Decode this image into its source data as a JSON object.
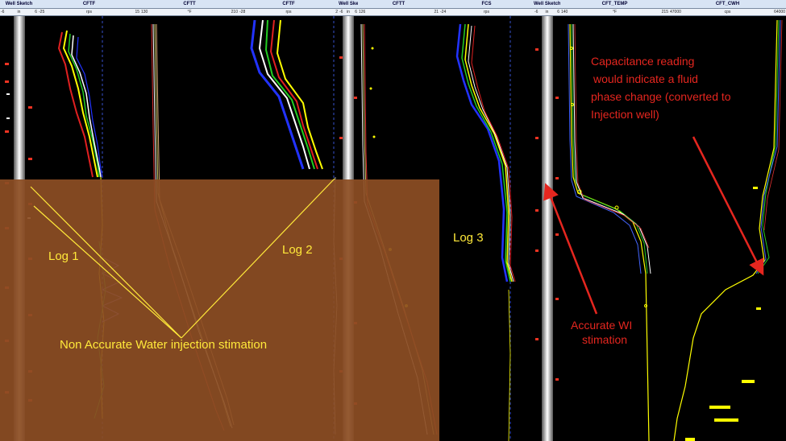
{
  "left_panel": {
    "tracks": [
      {
        "id": "well-sketch-1",
        "title": "Well Sketch",
        "scale_left": "-6",
        "scale_mid": "in",
        "scale_right": "6"
      },
      {
        "id": "cftf-1",
        "title": "CFTF",
        "scale_left": "-25",
        "scale_mid": "rps",
        "scale_right": "15"
      },
      {
        "id": "cftt-1",
        "title": "CFTT",
        "scale_left": "130",
        "scale_mid": "°F",
        "scale_right": "210"
      },
      {
        "id": "cftf-2",
        "title": "CFTF",
        "scale_left": "-28",
        "scale_mid": "rps",
        "scale_right": "2"
      },
      {
        "id": "well-sketch-2",
        "title": "Well Sketc",
        "scale_left": "-6",
        "scale_mid": "in",
        "scale_right": "6"
      },
      {
        "id": "cftt-2",
        "title": "CFTT",
        "scale_left": "126",
        "scale_mid": "",
        "scale_right": "21"
      }
    ]
  },
  "right_panel": {
    "tracks": [
      {
        "id": "fcs",
        "title": "FCS",
        "scale_left": "-24",
        "scale_mid": "rps",
        "scale_right": ""
      },
      {
        "id": "well-sketch-3",
        "title": "Well Sketch",
        "scale_left": "-6",
        "scale_mid": "in",
        "scale_right": "6"
      },
      {
        "id": "cft-temp",
        "title": "CFT_TEMP",
        "scale_left": "140",
        "scale_mid": "°F",
        "scale_right": "215"
      },
      {
        "id": "cft-cwh",
        "title": "CFT_CWH",
        "scale_left": "47000",
        "scale_mid": "cps",
        "scale_right": "64000"
      }
    ]
  },
  "annotations": {
    "log1": "Log 1",
    "log2": "Log 2",
    "log3": "Log 3",
    "non_accurate": "Non Accurate Water injection stimation",
    "accurate_wi_1": "Accurate WI",
    "accurate_wi_2": "stimation",
    "capacitance_1": "Capacitance reading",
    "capacitance_2": "would indicate a fluid",
    "capacitance_3": "phase change (converted to",
    "capacitance_4": "Injection well)"
  },
  "colors": {
    "annotation_yellow": "#ffe93a",
    "annotation_red": "#e5261f",
    "overlay_orange": "#8c4e24"
  }
}
